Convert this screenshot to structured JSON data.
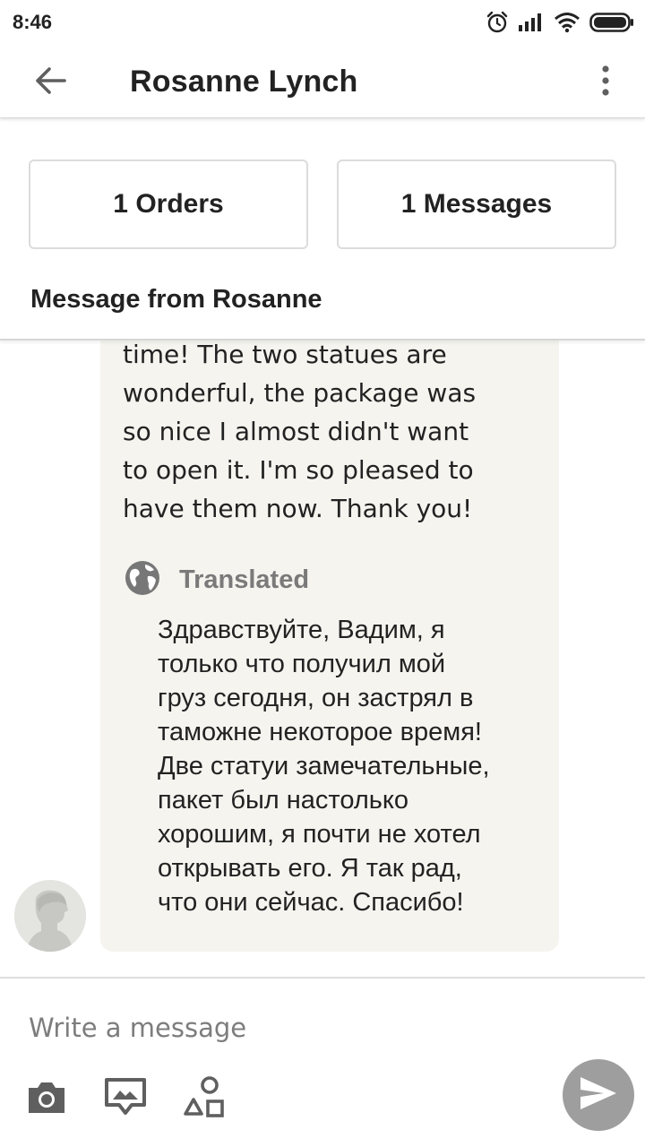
{
  "status_bar": {
    "time": "8:46",
    "icons": [
      "alarm-icon",
      "signal-icon",
      "wifi-icon",
      "battery-icon"
    ]
  },
  "app_bar": {
    "title": "Rosanne Lynch",
    "back_icon": "arrow-left-icon",
    "menu_icon": "more-vertical-icon"
  },
  "summary": {
    "orders_label": "1 Orders",
    "messages_label": "1 Messages"
  },
  "section": {
    "title": "Message from Rosanne"
  },
  "message": {
    "text": "time! The two statues are\nwonderful, the package was\nso nice I almost didn't want\nto open it.  I'm so pleased to\nhave them now. Thank you!",
    "translated_label": "Translated",
    "translated_icon": "globe-icon",
    "translated_text": "Здравствуйте, Вадим, я\nтолько что получил мой\nгруз сегодня, он застрял в\nтаможне некоторое время!\nДве статуи замечательные,\nпакет был настолько\nхорошим, я почти не хотел\nоткрывать его. Я так рад,\nчто они сейчас. Спасибо!"
  },
  "composer": {
    "placeholder": "Write a message",
    "tools": [
      "camera-icon",
      "image-frame-icon",
      "shapes-icon"
    ],
    "send_icon": "send-icon"
  },
  "colors": {
    "bubble_bg": "#f5f4ef",
    "send_button": "#9e9e9e",
    "muted_text": "#7a7a7a"
  }
}
